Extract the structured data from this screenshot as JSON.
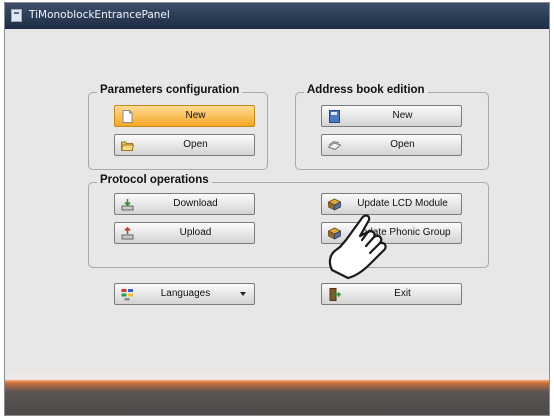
{
  "window": {
    "title": "TiMonoblockEntrancePanel"
  },
  "parameters": {
    "legend": "Parameters configuration",
    "new_label": "New",
    "open_label": "Open"
  },
  "address_book": {
    "legend": "Address book edition",
    "new_label": "New",
    "open_label": "Open"
  },
  "protocol": {
    "legend": "Protocol operations",
    "download_label": "Download",
    "upload_label": "Upload",
    "update_lcd_label": "Update LCD Module",
    "update_phonic_label": "Update Phonic Group"
  },
  "footer": {
    "languages_label": "Languages",
    "exit_label": "Exit"
  },
  "colors": {
    "active_button": "#f5a626",
    "title_bar": "#1d2c44",
    "accent_strip": "#ee8b50"
  }
}
